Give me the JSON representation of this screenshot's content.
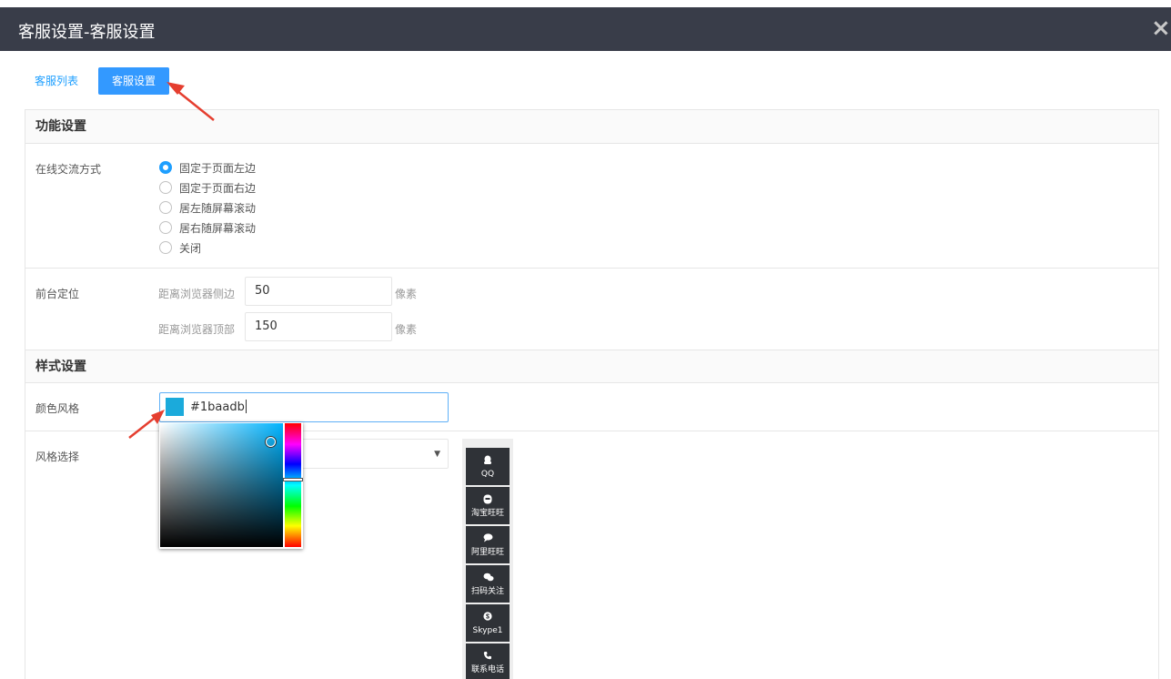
{
  "window": {
    "title": "客服设置-客服设置",
    "close_icon": "×"
  },
  "tabs": [
    {
      "label": "客服列表",
      "active": false
    },
    {
      "label": "客服设置",
      "active": true
    }
  ],
  "feature_section": {
    "title": "功能设置",
    "chat_mode": {
      "label": "在线交流方式",
      "options": [
        "固定于页面左边",
        "固定于页面右边",
        "居左随屏幕滚动",
        "居右随屏幕滚动",
        "关闭"
      ],
      "selected": "固定于页面左边"
    },
    "position": {
      "label": "前台定位",
      "side": {
        "label": "距离浏览器侧边",
        "value": "50",
        "unit": "像素"
      },
      "top": {
        "label": "距离浏览器顶部",
        "value": "150",
        "unit": "像素"
      }
    }
  },
  "style_section": {
    "title": "样式设置",
    "color": {
      "label": "颜色风格",
      "value": "#1baadb"
    },
    "style_choice": {
      "label": "风格选择",
      "value": ""
    }
  },
  "float_bar": {
    "items": [
      {
        "label": "QQ",
        "icon": "qq-icon"
      },
      {
        "label": "淘宝旺旺",
        "icon": "taobao-wangwang-icon"
      },
      {
        "label": "阿里旺旺",
        "icon": "aliwangwang-icon"
      },
      {
        "label": "扫码关注",
        "icon": "wechat-icon"
      },
      {
        "label": "Skype1",
        "icon": "skype-icon"
      },
      {
        "label": "联系电话",
        "icon": "phone-icon"
      }
    ]
  },
  "colors": {
    "title_bar": "#393d49",
    "accent": "#1e9fff",
    "active_tab": "#3399ff",
    "float_item": "#2f3237",
    "annotation_arrow": "#e53e2f"
  }
}
